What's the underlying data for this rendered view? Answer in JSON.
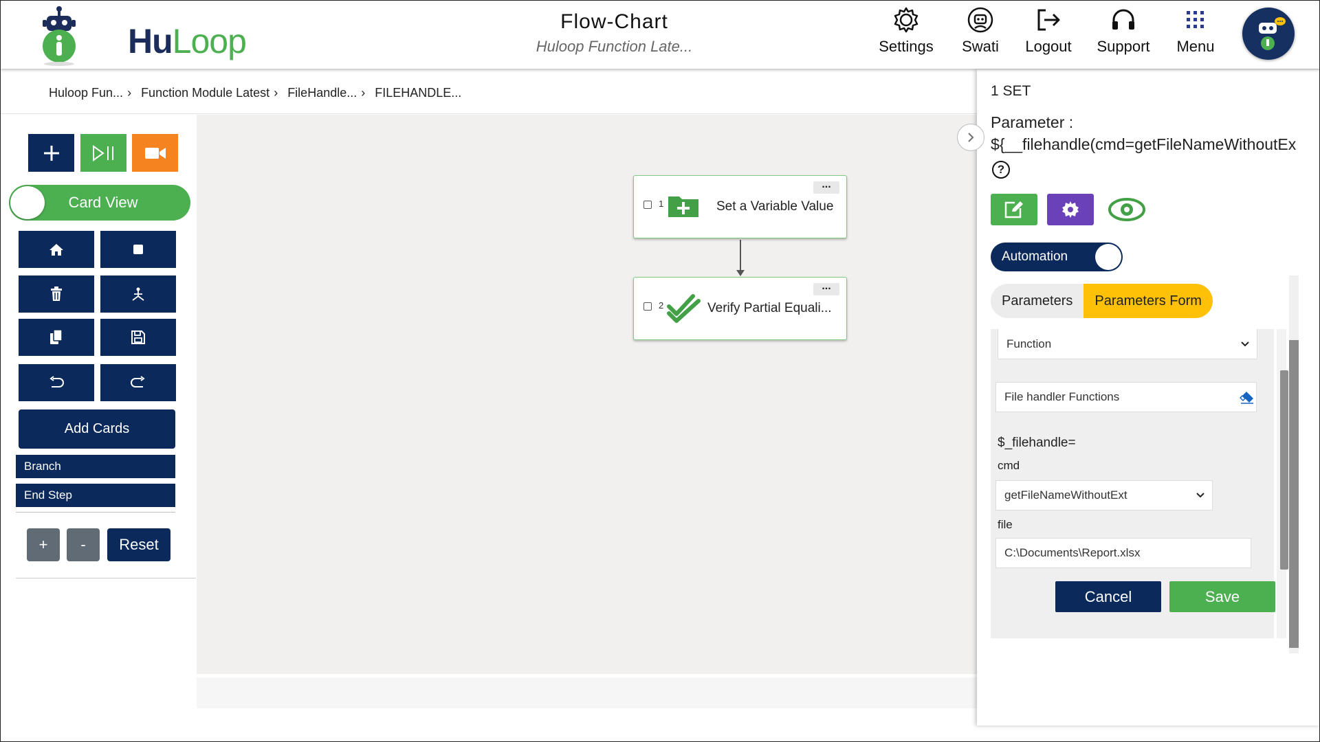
{
  "header": {
    "logo": {
      "hu": "Hu",
      "loop": "Loop"
    },
    "title": "Flow-Chart",
    "subtitle": "Huloop Function Late...",
    "nav": [
      {
        "label": "Settings",
        "icon": "gear-icon"
      },
      {
        "label": "Swati",
        "icon": "robot-user-icon"
      },
      {
        "label": "Logout",
        "icon": "logout-icon"
      },
      {
        "label": "Support",
        "icon": "headset-icon"
      },
      {
        "label": "Menu",
        "icon": "grid-menu-icon"
      }
    ]
  },
  "breadcrumb": [
    "Huloop Fun...",
    "Function Module Latest",
    "FileHandle...",
    "FILEHANDLE..."
  ],
  "toolbar": {
    "card_view_label": "Card View",
    "add_cards_label": "Add Cards",
    "branch_label": "Branch",
    "end_step_label": "End Step",
    "zoom_in_label": "+",
    "zoom_out_label": "-",
    "reset_label": "Reset"
  },
  "flow": {
    "cards": [
      {
        "number": "1",
        "text": "Set a Variable Value",
        "icon": "folder-plus-icon"
      },
      {
        "number": "2",
        "text": "Verify Partial Equali...",
        "icon": "double-check-icon"
      }
    ]
  },
  "panel": {
    "set_label": "1 SET",
    "parameter_label": "Parameter :",
    "parameter_value": "${__filehandle(cmd=getFileNameWithoutEx",
    "help_label": "?",
    "automation_label": "Automation",
    "tabs": [
      {
        "label": "Parameters",
        "active": false
      },
      {
        "label": "Parameters Form",
        "active": true
      }
    ],
    "form": {
      "function_select": "Function",
      "function_category": "File handler Functions",
      "prefix": "$_filehandle=",
      "cmd_label": "cmd",
      "cmd_value": "getFileNameWithoutExt",
      "file_label": "file",
      "file_value": "C:\\Documents\\Report.xlsx"
    },
    "cancel_label": "Cancel",
    "save_label": "Save"
  },
  "colors": {
    "navy": "#0b2a5b",
    "green": "#4caf50",
    "orange": "#f5831f",
    "purple": "#6a41b8",
    "yellow": "#ffc107"
  }
}
